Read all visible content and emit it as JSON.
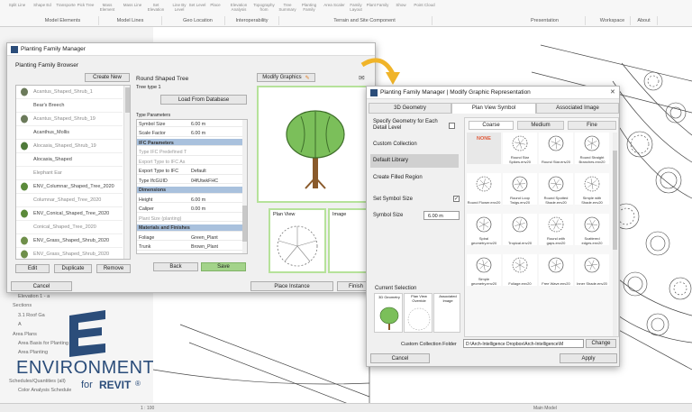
{
  "ribbon": {
    "buttons": [
      "Split Line",
      "Shape Ed",
      "Transporte",
      "Pick Tree",
      "Mass Element",
      "Mass Line",
      "Set Elevation",
      "Line By Level",
      "Set Level",
      "Place",
      "Elevation Analysis",
      "Topography from",
      "Tree Summary",
      "Planting Family",
      "Area Scaler",
      "Family Layout",
      "Plant Family",
      "Show",
      "Point Cloud"
    ],
    "panels": [
      "Model Elements",
      "Model Lines",
      "Geo Location",
      "Interoperability",
      "Terrain and Site Component",
      "Presentation",
      "Workspace",
      "About"
    ]
  },
  "project_browser": {
    "items": [
      "Elevation 1 - a",
      "Sections",
      "3.1 Roof Ga",
      "A",
      "Area Plans",
      "Area Basis for Planting",
      "Area Planting",
      "Schedules/Quantities (all)",
      "Color Analysis Schedule"
    ]
  },
  "logo": {
    "line1": "ENVIRONMENT",
    "line2": "for",
    "line3": "REVIT",
    "reg": "®"
  },
  "statusbar": {
    "scale": "1 : 100",
    "model": "Main Model"
  },
  "browser_window": {
    "title": "Planting Family Manager",
    "heading": "Planting Family Browser",
    "create_new": "Create New",
    "families": [
      "Acantus_Shaped_Shrub_1",
      "Bear's Breech",
      "Acantus_Shaped_Shrub_19",
      "Acanthus_Mollis",
      "Alocasia_Shaped_Shrub_19",
      "Alocasia_Shaped",
      "Elephant Ear",
      "ENV_Columnar_Shaped_Tree_2020",
      "Columnar_Shaped_Tree_2020",
      "ENV_Conical_Shaped_Tree_2020",
      "Conical_Shaped_Tree_2020",
      "ENV_Grass_Shaped_Shrub_2020",
      "ENV_Grass_Shaped_Shrub_2020"
    ],
    "edit": "Edit",
    "duplicate": "Duplicate",
    "remove": "Remove",
    "cancel": "Cancel",
    "tree_name": "Round Shaped Tree",
    "tree_type": "Tree type 1",
    "load_db": "Load From Database",
    "type_params": "Type Parameters",
    "props": [
      {
        "k": "Symbol Size",
        "v": "6.00 m"
      },
      {
        "k": "Scale Factor",
        "v": "6.00 m"
      },
      {
        "k": "IFC Parameters",
        "v": "",
        "sec": true
      },
      {
        "k": "Type IFC Predefined T",
        "v": ""
      },
      {
        "k": "Export Type to IFC As",
        "v": ""
      },
      {
        "k": "Export Type to IFC",
        "v": "Default"
      },
      {
        "k": "Type IfcGUID",
        "v": "04fUtwkFHC"
      },
      {
        "k": "Dimensions",
        "v": "",
        "sec": true
      },
      {
        "k": "Height",
        "v": "6.00 m"
      },
      {
        "k": "Caliper",
        "v": "0.00 m"
      },
      {
        "k": "Plant Size (planting)",
        "v": ""
      },
      {
        "k": "Materials and Finishes",
        "v": "",
        "sec": true
      },
      {
        "k": "Foliage",
        "v": "Green_Plant"
      },
      {
        "k": "Trunk",
        "v": "Brown_Plant"
      }
    ],
    "back": "Back",
    "save": "Save",
    "modify_graphics": "Modify Graphics",
    "plan_view": "Plan View",
    "image": "Image",
    "place_instance": "Place Instance",
    "finish": "Finish"
  },
  "graphic_window": {
    "title": "Planting Family Manager | Modify Graphic Representation",
    "tabs": [
      "3D Geometry",
      "Plan View Symbol",
      "Associated Image"
    ],
    "specify_label": "Specify Geometry for Each Detail Level",
    "nav": [
      "Custom Collection",
      "Default Library",
      "Create Filled Region"
    ],
    "set_symbol_size": "Set Symbol Size",
    "symbol_size_label": "Symbol Size",
    "symbol_size_value": "6.00 m",
    "subtabs": [
      "Coarse",
      "Medium",
      "Fine"
    ],
    "symbols": [
      "NONE",
      "Round Star Spikes.env20",
      "Round Star.env20",
      "Round Straight Branches.env20",
      "Round Flower.env20",
      "Round Loop Twigs.env20",
      "Round Spotted Shade.env20",
      "Simple with Shade.env20",
      "Spiral geometry.env20",
      "Tropical.env20",
      "Round with gaps.env20",
      "Scattered edges.env20",
      "Simple geometry.env20",
      "Foliage.env20",
      "Free Wave.env20",
      "Inner Shade.env20",
      "",
      "",
      "",
      ""
    ],
    "current_selection": "Current Selection",
    "sel_labels": [
      "3D Geometry",
      "Plan View Override",
      "Associated Image"
    ],
    "folder_label": "Custom Collection Folder",
    "folder_path": "D:\\Arch-Intelligence Dropbox\\Arch-Intelligence\\M",
    "change": "Change",
    "cancel": "Cancel",
    "apply": "Apply"
  },
  "colors": {
    "accent_green": "#a3d38a",
    "section_blue": "#a9c1dd",
    "arrow": "#f0b429",
    "logo_blue": "#2b4d7a"
  }
}
